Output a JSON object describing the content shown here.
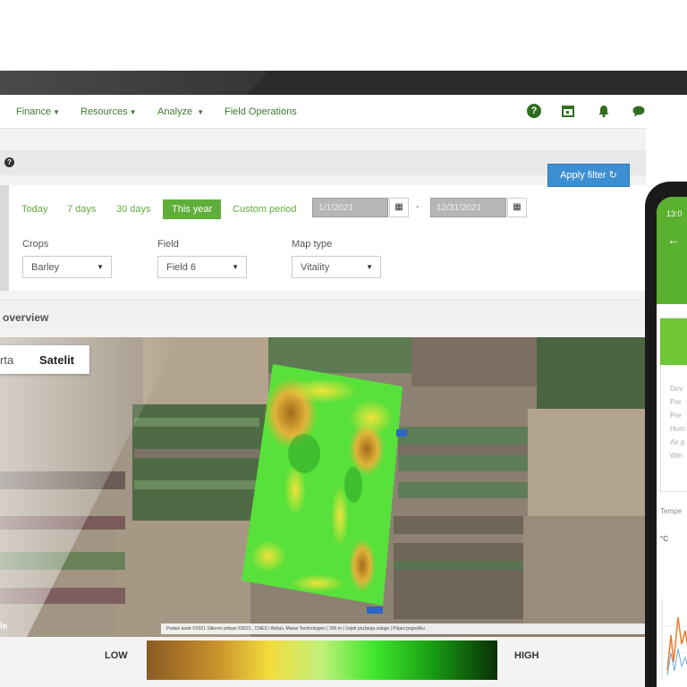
{
  "nav": {
    "items": [
      {
        "label": "Finance",
        "has_caret": true
      },
      {
        "label": "Resources",
        "has_caret": true
      },
      {
        "label": "Analyze",
        "has_caret": true
      },
      {
        "label": "Field Operations",
        "has_caret": false
      }
    ],
    "icons": [
      "help-icon",
      "calendar-icon",
      "bell-icon",
      "chat-icon",
      "hand-icon"
    ]
  },
  "filter": {
    "periods": [
      "Today",
      "7 days",
      "30 days",
      "This year",
      "Custom period"
    ],
    "active_period": "This year",
    "start_date": "1/1/2021",
    "end_date": "12/31/2021",
    "date_separator": "-",
    "crops_label": "Crops",
    "crops_value": "Barley",
    "field_label": "Field",
    "field_value": "Field 6",
    "maptype_label": "Map type",
    "maptype_value": "Vitality",
    "apply_label": "Apply filter"
  },
  "overview": {
    "title": "overview"
  },
  "map": {
    "tab_map": "rta",
    "tab_satellite": "Satelit",
    "google": "le",
    "attribution": "Podaci karte ©2021 Slikovni prikazi ©2021 , CNES / Airbus, Maxar Technologies | 200 m | Uvjeti pružanja usluge | Prijavi pogrešku"
  },
  "legend": {
    "low": "LOW",
    "high": "HIGH"
  },
  "phone": {
    "time": "13:0",
    "lines": [
      "Dev",
      "Pre",
      "Pre",
      "Hum",
      "Air p",
      "Win"
    ],
    "temperature_label": "Tempe",
    "unit": "°C"
  },
  "colors": {
    "brand_green": "#5fae3a",
    "nav_green": "#3a7d2c",
    "apply_blue": "#3d8fd1"
  }
}
